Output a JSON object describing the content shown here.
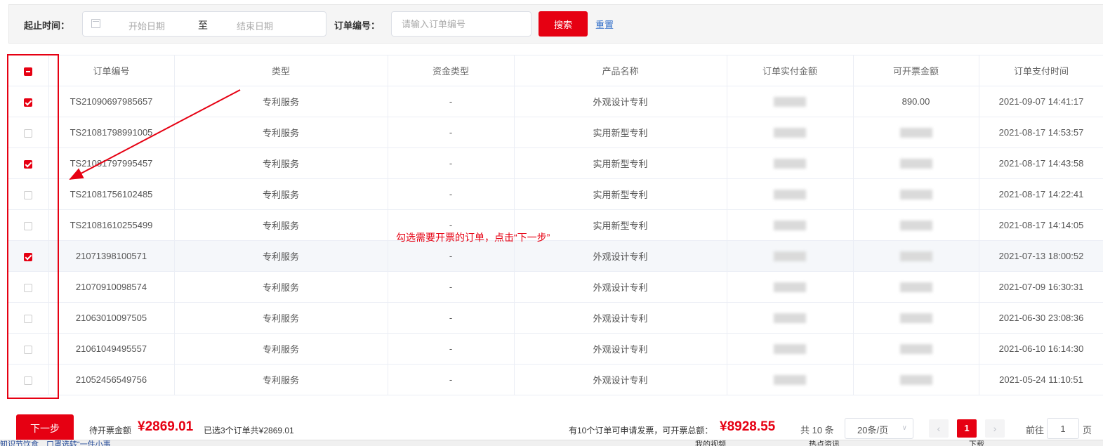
{
  "filter": {
    "date_label": "起止时间：",
    "start_placeholder": "开始日期",
    "range_separator": "至",
    "end_placeholder": "结束日期",
    "order_label": "订单编号：",
    "order_placeholder": "请输入订单编号",
    "search_label": "搜索",
    "reset_label": "重置"
  },
  "table": {
    "columns": [
      "订单编号",
      "类型",
      "资金类型",
      "产品名称",
      "订单实付金额",
      "可开票金额",
      "订单支付时间"
    ],
    "rows": [
      {
        "checked": true,
        "order_no": "TS21090697985657",
        "type": "专利服务",
        "fund_type": "-",
        "product": "外观设计专利",
        "paid_amount": "",
        "invoice_amount": "890.00",
        "pay_time": "2021-09-07 14:41:17"
      },
      {
        "checked": false,
        "order_no": "TS21081798991005",
        "type": "专利服务",
        "fund_type": "-",
        "product": "实用新型专利",
        "paid_amount": "",
        "invoice_amount": "",
        "pay_time": "2021-08-17 14:53:57"
      },
      {
        "checked": true,
        "order_no": "TS21081797995457",
        "type": "专利服务",
        "fund_type": "-",
        "product": "实用新型专利",
        "paid_amount": "",
        "invoice_amount": "",
        "pay_time": "2021-08-17 14:43:58"
      },
      {
        "checked": false,
        "order_no": "TS21081756102485",
        "type": "专利服务",
        "fund_type": "-",
        "product": "实用新型专利",
        "paid_amount": "",
        "invoice_amount": "",
        "pay_time": "2021-08-17 14:22:41"
      },
      {
        "checked": false,
        "order_no": "TS21081610255499",
        "type": "专利服务",
        "fund_type": "-",
        "product": "实用新型专利",
        "paid_amount": "",
        "invoice_amount": "",
        "pay_time": "2021-08-17 14:14:05"
      },
      {
        "checked": true,
        "order_no": "21071398100571",
        "type": "专利服务",
        "fund_type": "-",
        "product": "外观设计专利",
        "paid_amount": "",
        "invoice_amount": "",
        "pay_time": "2021-07-13 18:00:52"
      },
      {
        "checked": false,
        "order_no": "21070910098574",
        "type": "专利服务",
        "fund_type": "-",
        "product": "外观设计专利",
        "paid_amount": "",
        "invoice_amount": "",
        "pay_time": "2021-07-09 16:30:31"
      },
      {
        "checked": false,
        "order_no": "21063010097505",
        "type": "专利服务",
        "fund_type": "-",
        "product": "外观设计专利",
        "paid_amount": "",
        "invoice_amount": "",
        "pay_time": "2021-06-30 23:08:36"
      },
      {
        "checked": false,
        "order_no": "21061049495557",
        "type": "专利服务",
        "fund_type": "-",
        "product": "外观设计专利",
        "paid_amount": "",
        "invoice_amount": "",
        "pay_time": "2021-06-10 16:14:30"
      },
      {
        "checked": false,
        "order_no": "21052456549756",
        "type": "专利服务",
        "fund_type": "-",
        "product": "外观设计专利",
        "paid_amount": "",
        "invoice_amount": "",
        "pay_time": "2021-05-24 11:10:51"
      }
    ]
  },
  "annotation": "勾选需要开票的订单，点击“下一步”",
  "footer": {
    "next_label": "下一步",
    "pending_label": "待开票金额",
    "pending_amount": "¥2869.01",
    "selected_summary": "已选3个订单共¥2869.01",
    "available_label": "有10个订单可申请发票，可开票总额：",
    "available_amount": "¥8928.55",
    "total_text": "共 10 条",
    "page_size": "20条/页",
    "current_page": "1",
    "goto_label": "前往",
    "goto_value": "1",
    "page_suffix": "页"
  },
  "taskbar": {
    "left_text": "知识节饮食　口罩选转“一件小事",
    "mid_text": "我的视频",
    "right_text": "热点资讯",
    "download_text": "下载"
  },
  "colors": {
    "accent": "#e60012",
    "link": "#2a6ac8"
  }
}
